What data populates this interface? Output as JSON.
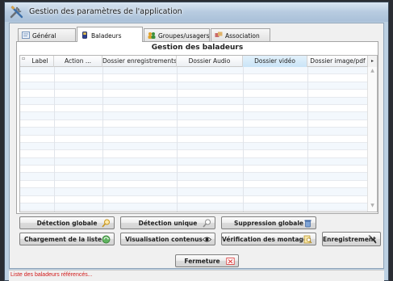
{
  "window": {
    "title": "Gestion des paramètres de l'application"
  },
  "tabs": [
    {
      "label": "Général",
      "icon": "general-tab-icon",
      "active": false
    },
    {
      "label": "Baladeurs",
      "icon": "player-device-icon",
      "active": true
    },
    {
      "label": "Groupes/usagers",
      "icon": "users-group-icon",
      "active": false
    },
    {
      "label": "Association",
      "icon": "association-icon",
      "active": false
    }
  ],
  "grid": {
    "title": "Gestion des baladeurs",
    "columns": [
      "Label",
      "Action ...",
      "Dossier enregistrements",
      "Dossier Audio",
      "Dossier vidéo",
      "Dossier image/pdf"
    ],
    "selected_column": "Dossier vidéo",
    "rows": []
  },
  "buttons": {
    "detection_globale": "Détection globale",
    "detection_unique": "Détection unique",
    "suppression_globale": "Suppression globale",
    "chargement_liste": "Chargement de la liste",
    "visualisation_contenus": "Visualisation contenus",
    "verification_montages": "Vérification des montages",
    "enregistrement": "Enregistrement",
    "fermeture": "Fermeture"
  },
  "status": {
    "text": "Liste des baladeurs référencés..."
  },
  "colors": {
    "status_text": "#d21a1a",
    "selected_header": "#c9e4f7",
    "row_alt": "#f3f8fd"
  }
}
